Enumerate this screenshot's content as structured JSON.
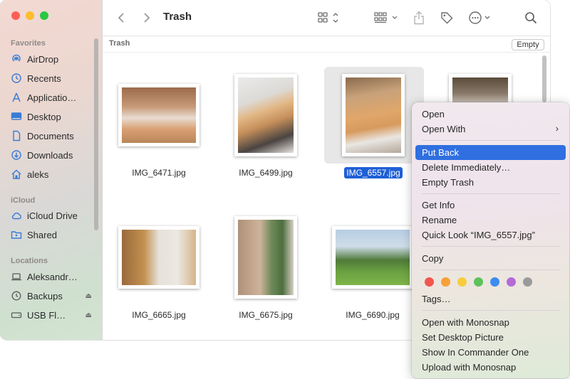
{
  "window": {
    "title": "Trash",
    "path_label": "Trash",
    "empty_label": "Empty"
  },
  "sidebar": {
    "favorites_label": "Favorites",
    "favorites": [
      {
        "label": "AirDrop",
        "icon": "airdrop-icon"
      },
      {
        "label": "Recents",
        "icon": "clock-icon"
      },
      {
        "label": "Applicatio…",
        "icon": "applications-icon"
      },
      {
        "label": "Desktop",
        "icon": "desktop-icon"
      },
      {
        "label": "Documents",
        "icon": "document-icon"
      },
      {
        "label": "Downloads",
        "icon": "download-icon"
      },
      {
        "label": "aleks",
        "icon": "home-icon"
      }
    ],
    "icloud_label": "iCloud",
    "icloud": [
      {
        "label": "iCloud Drive",
        "icon": "cloud-icon"
      },
      {
        "label": "Shared",
        "icon": "shared-folder-icon"
      }
    ],
    "locations_label": "Locations",
    "locations": [
      {
        "label": "Aleksandr…",
        "icon": "laptop-icon"
      },
      {
        "label": "Backups",
        "icon": "time-machine-icon"
      },
      {
        "label": "USB Fl…",
        "icon": "drive-icon"
      }
    ]
  },
  "files": [
    {
      "name": "IMG_6471.jpg"
    },
    {
      "name": "IMG_6499.jpg"
    },
    {
      "name": "IMG_6557.jpg",
      "selected": true
    },
    {
      "name": "IMG_6665.jpg"
    },
    {
      "name": "IMG_6675.jpg"
    },
    {
      "name": "IMG_6690.jpg"
    }
  ],
  "context_menu": {
    "open": "Open",
    "open_with": "Open With",
    "put_back": "Put Back",
    "delete_immediately": "Delete Immediately…",
    "empty_trash": "Empty Trash",
    "get_info": "Get Info",
    "rename": "Rename",
    "quick_look": "Quick Look “IMG_6557.jpg”",
    "copy": "Copy",
    "tags": "Tags…",
    "open_with_monosnap": "Open with Monosnap",
    "set_desktop_picture": "Set Desktop Picture",
    "show_in_commander": "Show In Commander One",
    "upload_monosnap": "Upload with Monosnap",
    "tag_colors": [
      "#f2564d",
      "#f7a035",
      "#f7cd3d",
      "#5dc259",
      "#3c8cf0",
      "#b56ad6",
      "#9a9a9a"
    ]
  },
  "colors": {
    "accent": "#2f6fe0",
    "selection_text_bg": "#1f5fd6"
  }
}
